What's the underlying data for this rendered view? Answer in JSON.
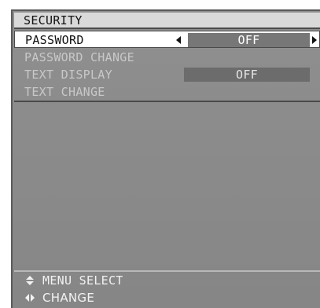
{
  "menu": {
    "title": "SECURITY",
    "items": [
      {
        "label": "PASSWORD",
        "value": "OFF",
        "state": "selected"
      },
      {
        "label": "PASSWORD CHANGE",
        "value": "",
        "state": "disabled"
      },
      {
        "label": "TEXT DISPLAY",
        "value": "OFF",
        "state": "disabled"
      },
      {
        "label": "TEXT CHANGE",
        "value": "",
        "state": "disabled"
      }
    ]
  },
  "footer": {
    "menu_select": "MENU SELECT",
    "change": "CHANGE",
    "menu_select_icon": "up-down-diamond-icon",
    "change_icon": "left-right-diamond-icon"
  },
  "colors": {
    "panel_bg": "#8a8a8a",
    "selected_bg": "#ffffff",
    "value_bg": "#777777",
    "disabled_text": "#c8c8c8"
  }
}
